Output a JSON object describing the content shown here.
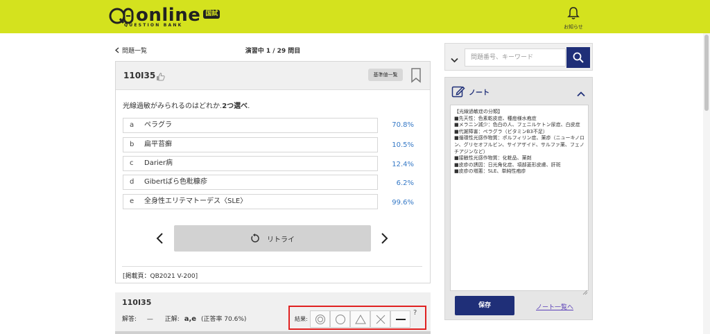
{
  "header": {
    "logo_text": "online",
    "logo_badge": "国試",
    "logo_sub": "QUESTION BANK",
    "notification_label": "お知らせ",
    "bg_color": "#d4e21e"
  },
  "nav": {
    "back_label": "問題一覧",
    "progress": "演習中 1 / 29 問目"
  },
  "question": {
    "id": "110I35",
    "ref_button": "基準値一覧",
    "text_prefix": "光線過敏がみられるのはどれか.",
    "text_emphasis": "2つ選べ",
    "text_suffix": ".",
    "choices": [
      {
        "letter": "a",
        "text": "ペラグラ",
        "pct": "70.8%"
      },
      {
        "letter": "b",
        "text": "扁平苔癬",
        "pct": "10.5%"
      },
      {
        "letter": "c",
        "text": "Darier病",
        "pct": "12.4%"
      },
      {
        "letter": "d",
        "text": "Gibertばら色粃糠疹",
        "pct": "6.2%"
      },
      {
        "letter": "e",
        "text": "全身性エリテマトーデス〈SLE〉",
        "pct": "99.6%"
      }
    ],
    "retry_label": "リトライ",
    "page_ref": "[掲載頁：QB2021 V-200]"
  },
  "answer": {
    "id": "110I35",
    "your_answer_label": "解答:",
    "your_answer_value": "—",
    "correct_label": "正解:",
    "correct_value": "a,e",
    "rate": "(正答率 70.6%)",
    "result_label": "結果:",
    "help": "?"
  },
  "search": {
    "placeholder": "問題番号、キーワード"
  },
  "note": {
    "title": "ノート",
    "body": "【光線過敏症の分類】\n■先天性：色素乾皮症、種痘様水疱症\n■メラニン減少：色白の人、フェニルケトン尿症、白皮症\n■代謝障害：ペラグラ（ビタミンB3不足）\n■循環性光感作物質：ポルフィリン症、薬疹（ニューキノロン、グリセオフルビン、サイアザイド、サルファ薬、フェノチアジンなど）\n■接触性光感作物質：化粧品、薬剤\n■皮疹の誘因：日光角化症、項部菱形皮膚、肝斑\n■皮疹の増悪：SLE、単純性疱疹",
    "save_label": "保存",
    "list_link": "ノート一覧へ"
  }
}
